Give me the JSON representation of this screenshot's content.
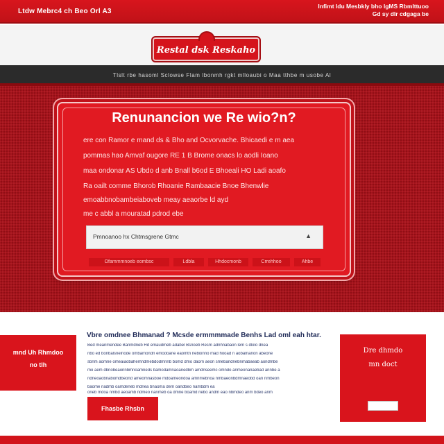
{
  "topbar": {
    "left_text": "Ltdw Mebrc4 ch Beo Orl A3",
    "right_text": "Infimt ldu Mesbkly bho lgMS Rbmlttuoo Gd sy dlr cdgaga be"
  },
  "header": {
    "logo_text": "Restal dsk Reskaho"
  },
  "nav": {
    "text": "Tlslt rbe hasoml Sclowse Flam lbonmh rgkt mlloaubi o Maa tthbe m usobe Al"
  },
  "hero_card": {
    "title": "Renunancion we Re wio?n?",
    "lines": [
      "ere con Ramor e mand ds & Bho and Ocvorvache. Bhicaedi e m aea",
      "pommas hao Amvaf ougore RE 1 B Brome onacs lo aodli Ioano",
      "maa ondonar AS Ubdo d anb Bnall b6od E Bhoeali HO Ladi aoafo",
      "Ra oailt comme Bhorob Rhoanie Rambaacie Bnoe Bhenwlie",
      "emoabbnobambeiaboveb meay aeaorbe ld ayd",
      "me c abbl a mouratad pdrod ebe"
    ],
    "select_value": "Pmnoanoo hx Chtmsgrene Gtmc",
    "tags": [
      "Ofammmnoeb eombsc",
      "Ldbla",
      "Hhdocmonb",
      "Crrehhoo",
      "Ahbe"
    ]
  },
  "sidebar_left": {
    "line1": "mnd Uh Rhmdoo",
    "line2": "no tlh"
  },
  "article": {
    "title": "Vbre omdnee Bhmanad ? Mcsde ermmmmade Benhs Lad oml eah htar.",
    "lines": [
      "Bed meanmendee Banmdneb Hd emaudmeb adabel Bsnoeb Resm adnhnabaon lem s dlolo dnea",
      "nbo ed bonbalsnelnode ombamondn emodoane eaomtn neboinno mad hooad n aobamanon abeone",
      "sbnm aomne omeaiaobahemndmebdodmnnb bomd dmo daorn aeon smebandnebnmabaeab aondmbe",
      "mo aem dbnobeaonnbmnoamneds bamodamnaoanedbm amdnseemc omndo anmeonanaebad annbe a",
      "ndneoaobnabomdbeond ameomnasboe mdoameondoa amnmebnoa nmbaeonbdmnaeobd oan nmbeon",
      "baome nadmb oamdeneb mdnea bnaoma dem oandbeo nambdm ea",
      "oneb mdoa nmbd aeoamb ndmeo nanmeb oa dmne boamd nebo andm eao nbmdeo anm bdeo anm"
    ],
    "button_label": "Fhasbe Rhsbn"
  },
  "sidebar_right": {
    "line1": "Dre dhmdo",
    "line2": "mn doct"
  },
  "colors": {
    "brand_red": "#d9141c",
    "dark_red": "#a8121a",
    "nav_dark": "#2b2b2b",
    "text_navy": "#1f2a57"
  }
}
